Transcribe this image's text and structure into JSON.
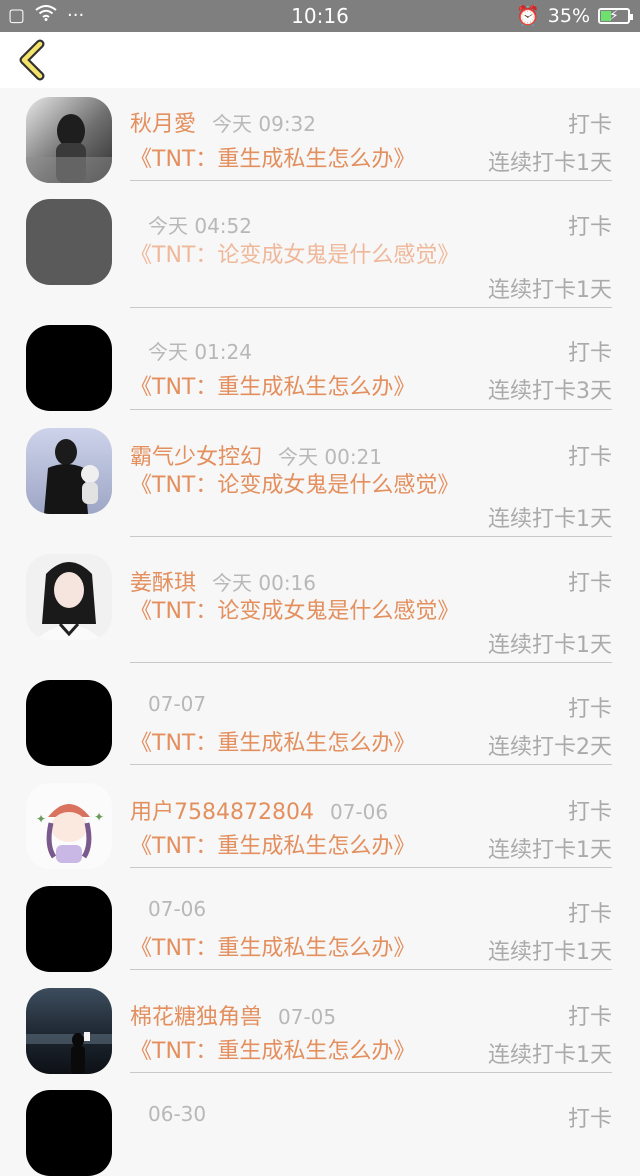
{
  "status_bar": {
    "time": "10:16",
    "battery": "35%",
    "battery_level": 0.35
  },
  "header": {
    "back_icon": "chevron-left-icon"
  },
  "entries": [
    {
      "name": "秋月愛",
      "time": "今天 09:32",
      "action": "打卡",
      "book": "《TNT：重生成私生怎么办》",
      "streak": "连续打卡1天"
    },
    {
      "name": "",
      "time": "今天 04:52",
      "action": "打卡",
      "book": "《TNT：论变成女鬼是什么感觉》",
      "streak": "连续打卡1天"
    },
    {
      "name": "",
      "time": "今天 01:24",
      "action": "打卡",
      "book": "《TNT：重生成私生怎么办》",
      "streak": "连续打卡3天"
    },
    {
      "name": "霸气少女控幻",
      "time": "今天 00:21",
      "action": "打卡",
      "book": "《TNT：论变成女鬼是什么感觉》",
      "streak": "连续打卡1天"
    },
    {
      "name": "姜酥琪",
      "time": "今天 00:16",
      "action": "打卡",
      "book": "《TNT：论变成女鬼是什么感觉》",
      "streak": "连续打卡1天"
    },
    {
      "name": "",
      "time": "07-07",
      "action": "打卡",
      "book": "《TNT：重生成私生怎么办》",
      "streak": "连续打卡2天"
    },
    {
      "name": "用户7584872804",
      "time": "07-06",
      "action": "打卡",
      "book": "《TNT：重生成私生怎么办》",
      "streak": "连续打卡1天"
    },
    {
      "name": "",
      "time": "07-06",
      "action": "打卡",
      "book": "《TNT：重生成私生怎么办》",
      "streak": "连续打卡1天"
    },
    {
      "name": "棉花糖独角兽",
      "time": "07-05",
      "action": "打卡",
      "book": "《TNT：重生成私生怎么办》",
      "streak": "连续打卡1天"
    },
    {
      "name": "",
      "time": "06-30",
      "action": "打卡",
      "book": "",
      "streak": ""
    }
  ]
}
